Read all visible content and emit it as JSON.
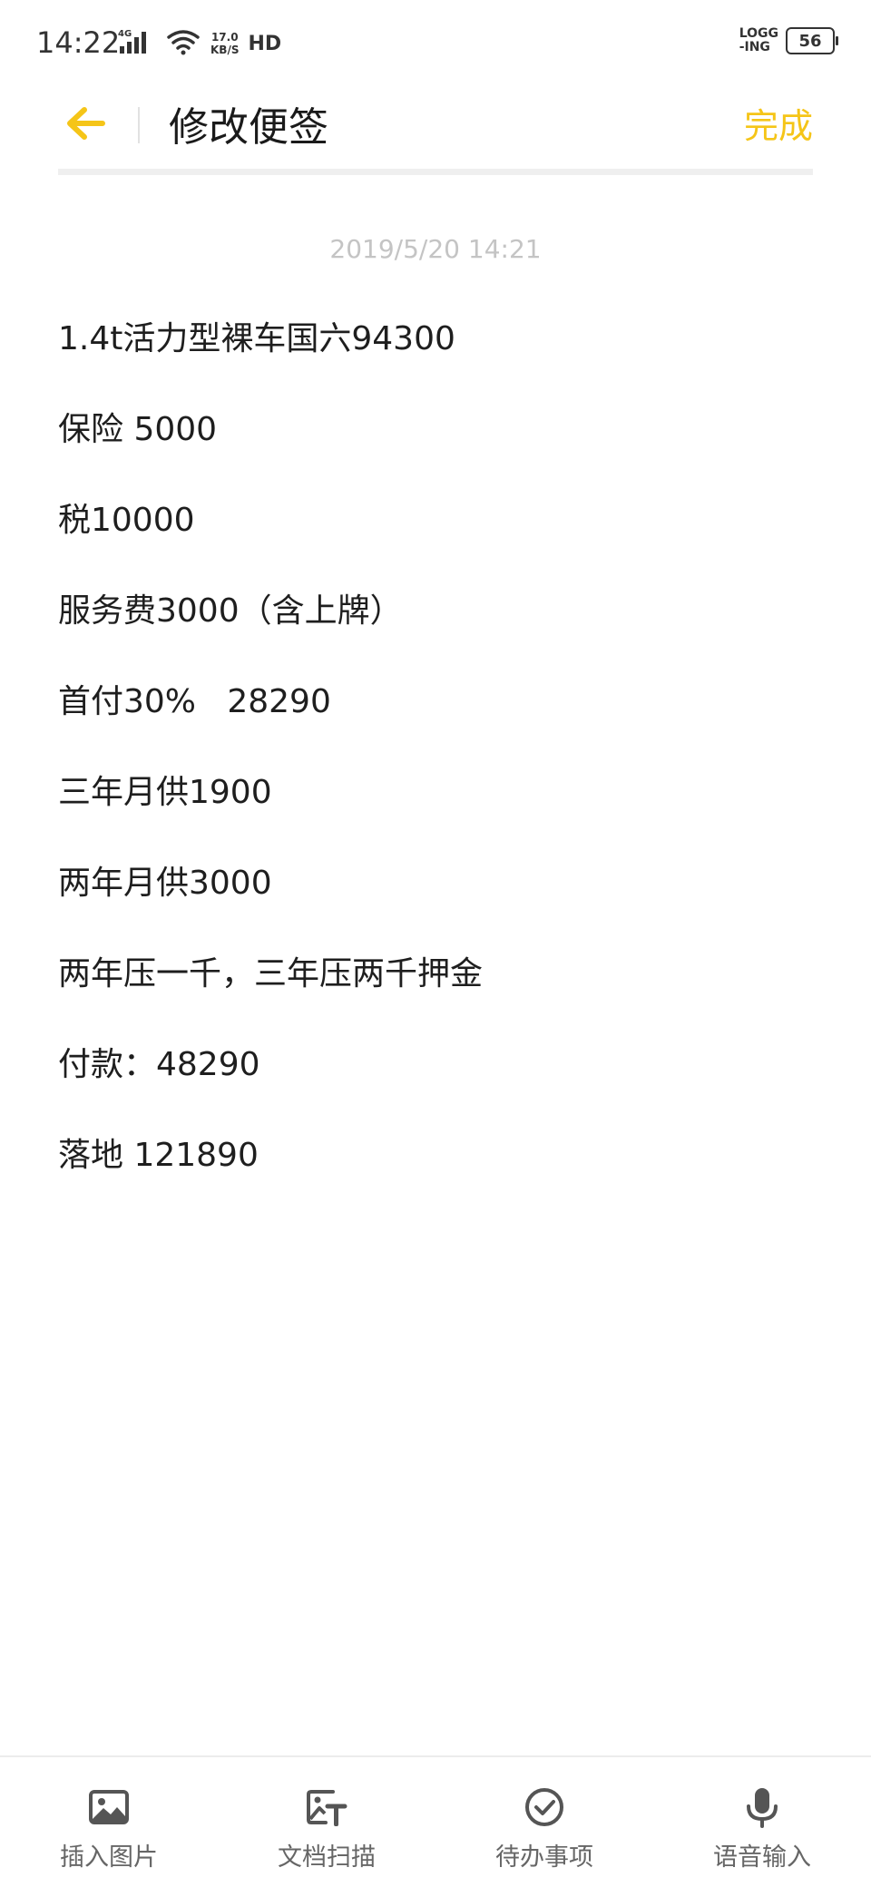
{
  "status_bar": {
    "time": "14:22",
    "network_type": "4G",
    "speed_value": "17.0",
    "speed_unit": "KB/S",
    "hd": "HD",
    "logging_top": "LOGG",
    "logging_bottom": "-ING",
    "battery": "56"
  },
  "header": {
    "title": "修改便签",
    "done_label": "完成"
  },
  "note": {
    "timestamp": "2019/5/20 14:21",
    "lines": [
      "1.4t活力型裸车国六94300",
      "保险 5000",
      "税10000",
      "服务费3000（含上牌）",
      "首付30%   28290",
      "三年月供1900",
      "两年月供3000",
      "两年压一千，三年压两千押金",
      "付款：48290",
      "落地 121890"
    ]
  },
  "toolbar": {
    "items": [
      {
        "label": "插入图片",
        "icon": "image-icon"
      },
      {
        "label": "文档扫描",
        "icon": "document-scan-icon"
      },
      {
        "label": "待办事项",
        "icon": "todo-check-icon"
      },
      {
        "label": "语音输入",
        "icon": "microphone-icon"
      }
    ]
  },
  "colors": {
    "accent": "#f5c518",
    "text": "#1e1e1e",
    "muted": "#c4c4c4"
  }
}
